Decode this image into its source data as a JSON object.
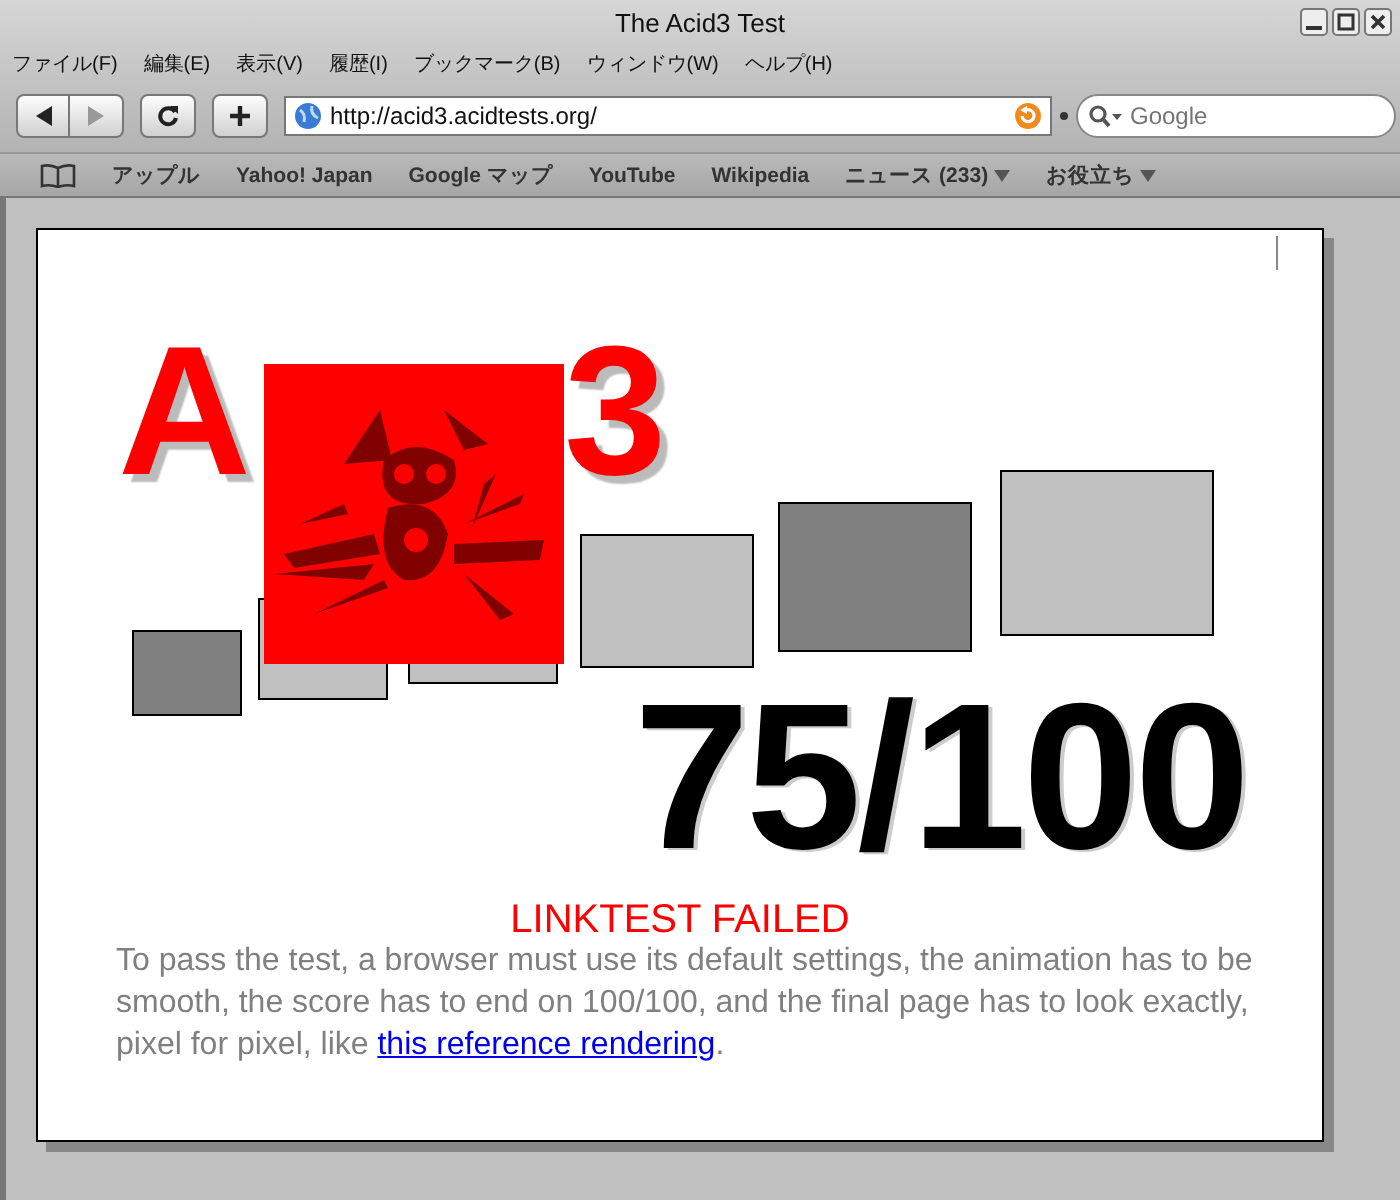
{
  "window": {
    "title": "The Acid3 Test"
  },
  "menu": [
    {
      "label": "ファイル(F)"
    },
    {
      "label": "編集(E)"
    },
    {
      "label": "表示(V)"
    },
    {
      "label": "履歴(I)"
    },
    {
      "label": "ブックマーク(B)"
    },
    {
      "label": "ウィンドウ(W)"
    },
    {
      "label": "ヘルプ(H)"
    }
  ],
  "toolbar": {
    "url": "http://acid3.acidtests.org/",
    "search": {
      "placeholder": "Google"
    }
  },
  "bookmarks": [
    {
      "label": "アップル",
      "kind": "link"
    },
    {
      "label": "Yahoo! Japan",
      "kind": "link"
    },
    {
      "label": "Google マップ",
      "kind": "link"
    },
    {
      "label": "YouTube",
      "kind": "link"
    },
    {
      "label": "Wikipedia",
      "kind": "link"
    },
    {
      "label": "ニュース (233)",
      "kind": "folder"
    },
    {
      "label": "お役立ち",
      "kind": "folder"
    }
  ],
  "page": {
    "title_parts": [
      "A",
      "3"
    ],
    "score": "75/100",
    "status": "LINKTEST FAILED",
    "description": {
      "before": "To pass the test, a browser must use its default settings, the animation has to be smooth, the score has to end on 100/100, and the final page has to look exactly, pixel for pixel, like ",
      "link": "this reference rendering",
      "after": "."
    }
  }
}
